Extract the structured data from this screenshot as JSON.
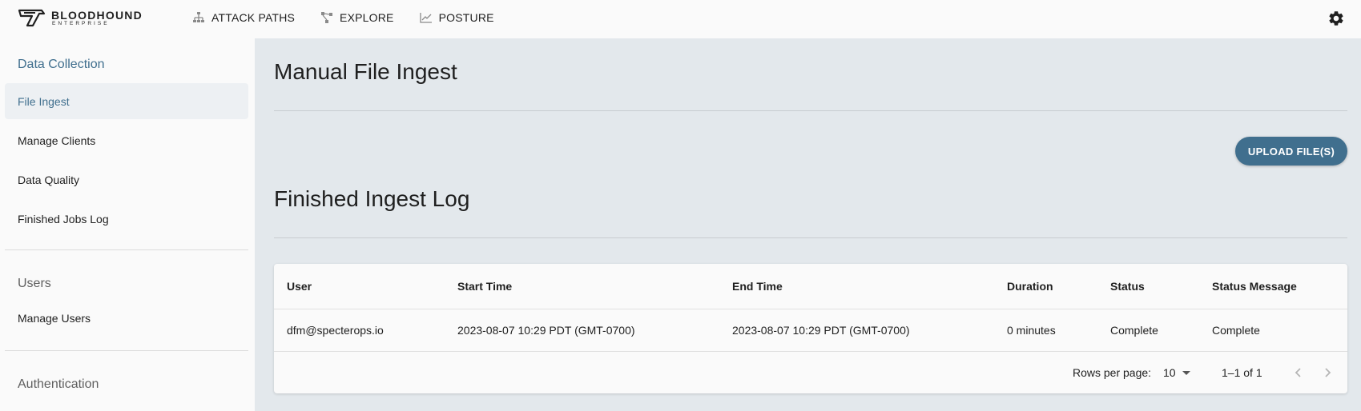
{
  "header": {
    "logo_text": "BLOODHOUND",
    "logo_sub": "ENTERPRISE",
    "nav": [
      {
        "label": "ATTACK PATHS",
        "icon": "hierarchy-icon"
      },
      {
        "label": "EXPLORE",
        "icon": "graph-nodes-icon"
      },
      {
        "label": "POSTURE",
        "icon": "trend-chart-icon"
      }
    ],
    "settings_icon": "gear-icon"
  },
  "sidebar": {
    "sections": [
      {
        "title": "Data Collection",
        "items": [
          "File Ingest",
          "Manage Clients",
          "Data Quality",
          "Finished Jobs Log"
        ],
        "selected": "File Ingest"
      },
      {
        "title": "Users",
        "items": [
          "Manage Users"
        ]
      },
      {
        "title": "Authentication",
        "items": []
      }
    ]
  },
  "main": {
    "title": "Manual File Ingest",
    "upload_label": "UPLOAD FILE(S)",
    "log_title": "Finished Ingest Log",
    "table": {
      "columns": [
        "User",
        "Start Time",
        "End Time",
        "Duration",
        "Status",
        "Status Message"
      ],
      "rows": [
        [
          "dfm@specterops.io",
          "2023-08-07 10:29 PDT (GMT-0700)",
          "2023-08-07 10:29 PDT (GMT-0700)",
          "0 minutes",
          "Complete",
          "Complete"
        ]
      ]
    },
    "pagination": {
      "rows_per_page_label": "Rows per page:",
      "rows_per_page": "10",
      "range": "1–1 of 1"
    }
  },
  "colors": {
    "accent": "#406f8e",
    "background": "#e3e8ec",
    "sidebar": "#fafafa"
  }
}
